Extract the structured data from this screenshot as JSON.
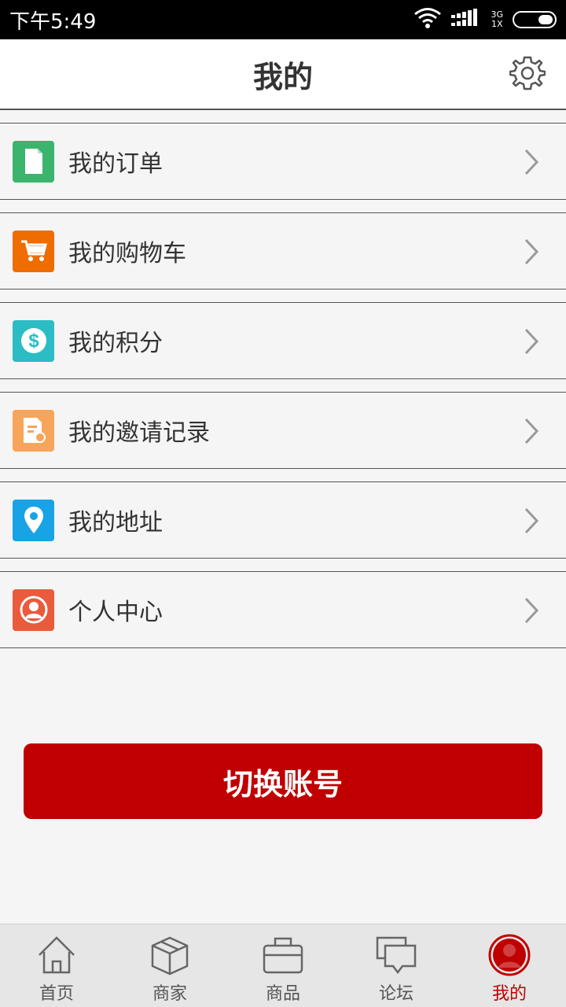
{
  "status_bar": {
    "time": "下午5:49",
    "network": "3G",
    "sim": "1X"
  },
  "header": {
    "title": "我的"
  },
  "menu": [
    {
      "label": "我的订单",
      "icon": "document-icon",
      "color": "#3bb46e"
    },
    {
      "label": "我的购物车",
      "icon": "cart-icon",
      "color": "#ef6c00"
    },
    {
      "label": "我的积分",
      "icon": "dollar-icon",
      "color": "#2bbcc4"
    },
    {
      "label": "我的邀请记录",
      "icon": "invite-record-icon",
      "color": "#f7a55a"
    },
    {
      "label": "我的地址",
      "icon": "location-pin-icon",
      "color": "#17a3e6"
    },
    {
      "label": "个人中心",
      "icon": "user-icon",
      "color": "#ea5a3d"
    }
  ],
  "switch_account": {
    "label": "切换账号",
    "color": "#c00000"
  },
  "bottom_nav": [
    {
      "label": "首页",
      "icon": "home-icon"
    },
    {
      "label": "商家",
      "icon": "box-icon"
    },
    {
      "label": "商品",
      "icon": "bag-icon"
    },
    {
      "label": "论坛",
      "icon": "chat-icon"
    },
    {
      "label": "我的",
      "icon": "profile-icon",
      "active": true
    }
  ]
}
